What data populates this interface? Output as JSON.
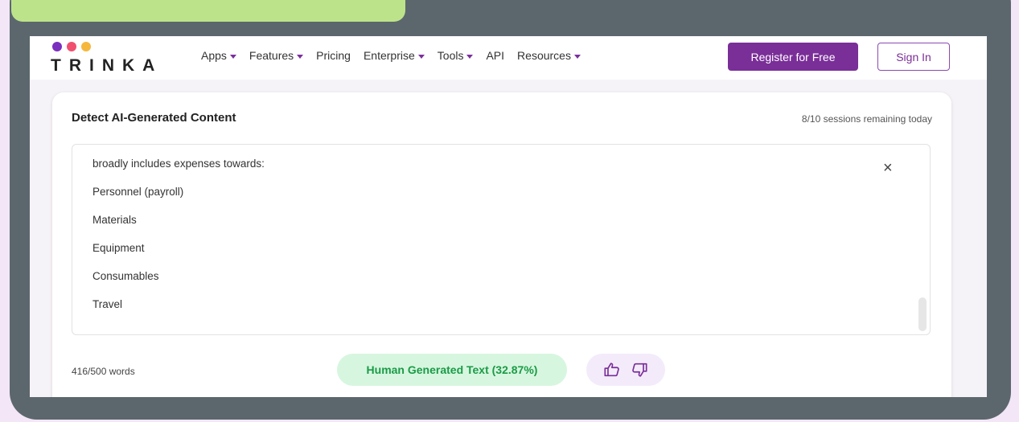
{
  "brand": {
    "name": "TRINKA",
    "dot_colors": [
      "#7b2fbe",
      "#f0506e",
      "#f5b83d"
    ]
  },
  "nav": {
    "items": [
      {
        "label": "Apps",
        "dropdown": true
      },
      {
        "label": "Features",
        "dropdown": true
      },
      {
        "label": "Pricing",
        "dropdown": false
      },
      {
        "label": "Enterprise",
        "dropdown": true
      },
      {
        "label": "Tools",
        "dropdown": true
      },
      {
        "label": "API",
        "dropdown": false
      },
      {
        "label": "Resources",
        "dropdown": true
      }
    ],
    "register_label": "Register for Free",
    "signin_label": "Sign In"
  },
  "detector": {
    "title": "Detect AI-Generated Content",
    "sessions": "8/10 sessions remaining today",
    "lines": [
      "broadly includes expenses towards:",
      "Personnel (payroll)",
      "Materials",
      "Equipment",
      "Consumables",
      "Travel"
    ],
    "close_icon": "×",
    "word_count": "416/500 words",
    "result": "Human Generated Text (32.87%)",
    "feedback_icons": [
      "thumbs-up-icon",
      "thumbs-down-icon"
    ]
  },
  "colors": {
    "accent": "#7a2e98",
    "result_bg": "#d7f6df",
    "result_text": "#1a9b47",
    "frame": "#5c676d",
    "tag": "#bde38a"
  }
}
